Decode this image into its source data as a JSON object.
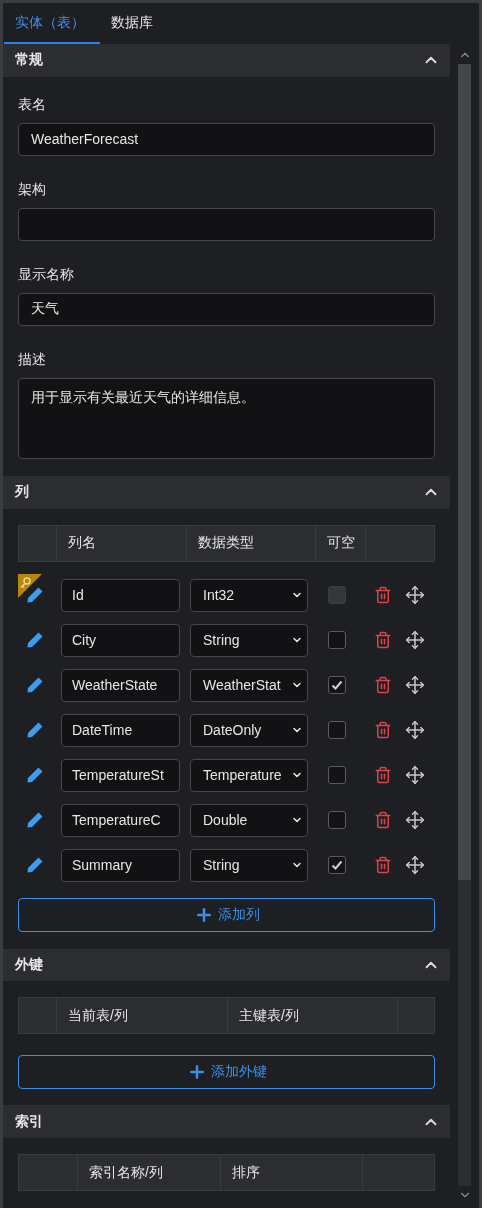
{
  "tabs": [
    {
      "label": "实体（表）",
      "selected": true
    },
    {
      "label": "数据库",
      "selected": false
    }
  ],
  "general": {
    "title": "常规",
    "expanded": true,
    "fields": [
      {
        "label": "表名",
        "value": "WeatherForecast",
        "kind": "input"
      },
      {
        "label": "架构",
        "kind": "input"
      },
      {
        "label": "显示名称",
        "value": "天气",
        "kind": "input"
      },
      {
        "label": "描述",
        "value": "用于显示有关最近天气的详细信息。",
        "kind": "textarea"
      }
    ]
  },
  "columns": {
    "title": "列",
    "expanded": true,
    "headers": [
      "列名",
      "数据类型",
      "可空"
    ],
    "rows": [
      {
        "primary_key": true,
        "name": "Id",
        "type": "Int32",
        "nullable": false,
        "disabled": true
      },
      {
        "primary_key": false,
        "name": "City",
        "type": "String",
        "nullable": false,
        "disabled": false
      },
      {
        "primary_key": false,
        "name": "WeatherState",
        "type": "WeatherStat",
        "nullable": true,
        "disabled": false
      },
      {
        "primary_key": false,
        "name": "DateTime",
        "type": "DateOnly",
        "nullable": false,
        "disabled": false
      },
      {
        "primary_key": false,
        "name": "TemperatureSt",
        "type": "Temperature",
        "nullable": false,
        "disabled": false
      },
      {
        "primary_key": false,
        "name": "TemperatureC",
        "type": "Double",
        "nullable": false,
        "disabled": false
      },
      {
        "primary_key": false,
        "name": "Summary",
        "type": "String",
        "nullable": true,
        "disabled": false
      }
    ],
    "add_button": "添加列"
  },
  "foreign_keys": {
    "title": "外键",
    "expanded": true,
    "headers": [
      "当前表/列",
      "主键表/列"
    ],
    "add_button": "添加外键"
  },
  "indexes": {
    "title": "索引",
    "expanded": true,
    "headers": [
      "索引名称/列",
      "排序"
    ]
  }
}
